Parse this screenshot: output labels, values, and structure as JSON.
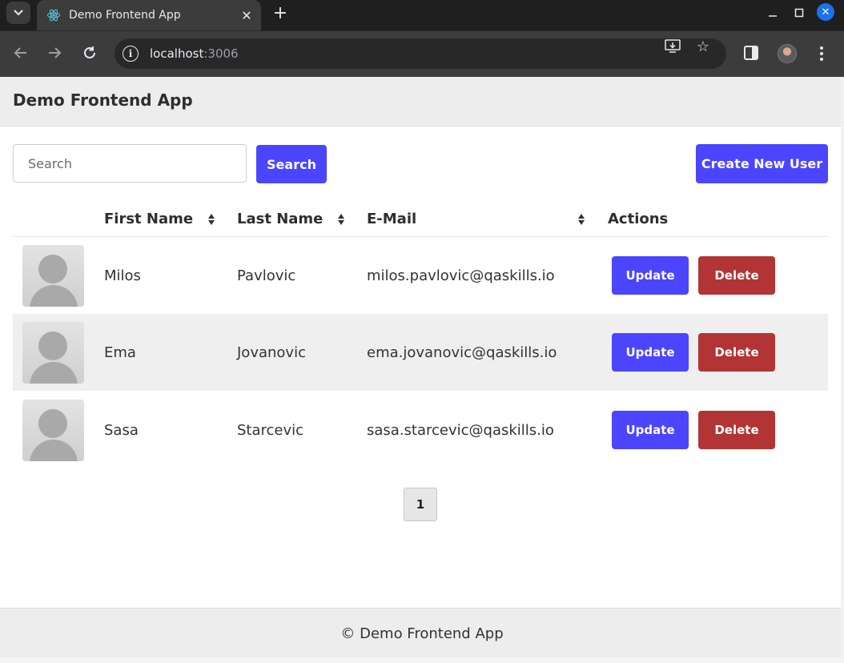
{
  "browser": {
    "tab_title": "Demo Frontend App",
    "url_host": "localhost",
    "url_port": ":3006",
    "icons": [
      "tab-list-icon",
      "react-icon",
      "close-icon",
      "plus-icon",
      "minimize-icon",
      "maximize-icon",
      "close-window-icon",
      "back-icon",
      "forward-icon",
      "reload-icon",
      "info-icon",
      "install-icon",
      "star-icon",
      "side-panel-icon",
      "profile-avatar",
      "more-menu-icon"
    ],
    "accent_color": "#1a73e8"
  },
  "header": {
    "title": "Demo Frontend App"
  },
  "search": {
    "placeholder": "Search",
    "value": "",
    "button_label": "Search"
  },
  "create_button_label": "Create New User",
  "table": {
    "columns": [
      "First Name",
      "Last Name",
      "E-Mail",
      "Actions"
    ],
    "rows": [
      {
        "first_name": "Milos",
        "last_name": "Pavlovic",
        "email": "milos.pavlovic@qaskills.io",
        "update_label": "Update",
        "delete_label": "Delete"
      },
      {
        "first_name": "Ema",
        "last_name": "Jovanovic",
        "email": "ema.jovanovic@qaskills.io",
        "update_label": "Update",
        "delete_label": "Delete"
      },
      {
        "first_name": "Sasa",
        "last_name": "Starcevic",
        "email": "sasa.starcevic@qaskills.io",
        "update_label": "Update",
        "delete_label": "Delete"
      }
    ]
  },
  "pagination": {
    "current_page": "1"
  },
  "footer": {
    "text": "© Demo Frontend App"
  },
  "colors": {
    "primary_button": "#4b45ff",
    "danger_button": "#b23434",
    "header_bg": "#ededed"
  }
}
